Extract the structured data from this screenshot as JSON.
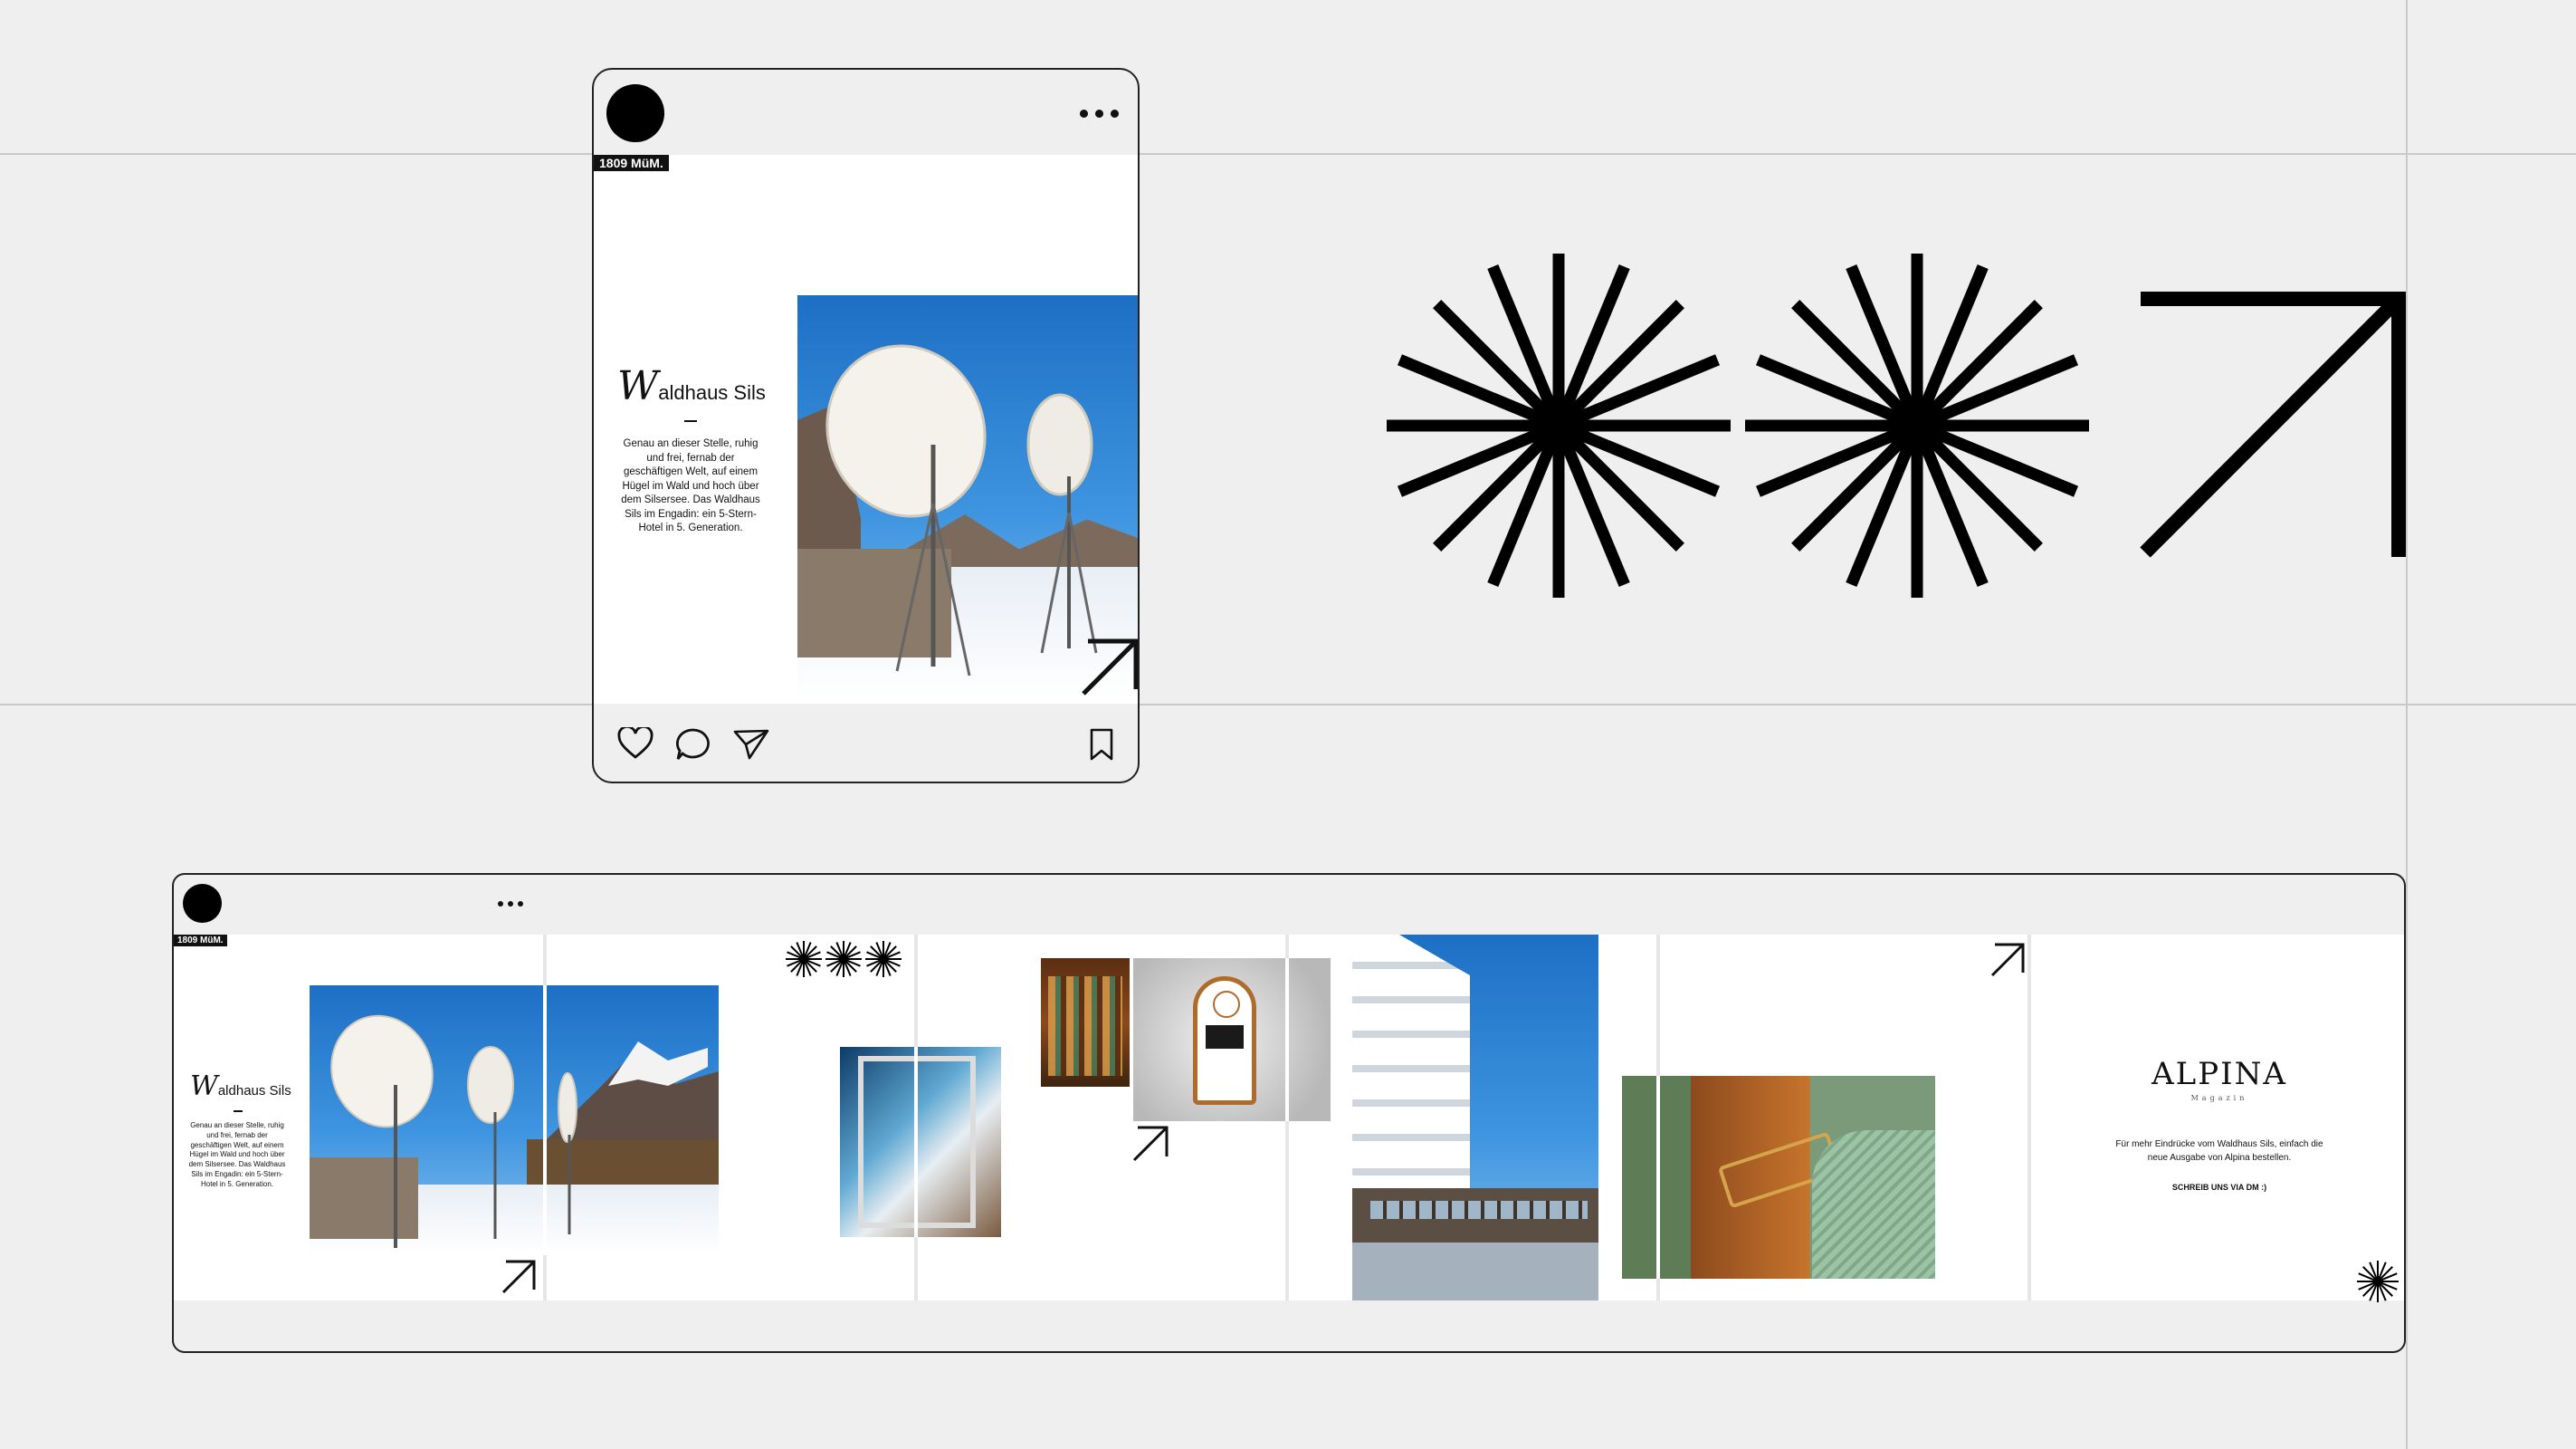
{
  "post": {
    "badge": "1809 MüM.",
    "title_initial": "W",
    "title_rest": "aldhaus Sils",
    "body": "Genau an dieser Stelle, ruhig und frei, fernab der geschäftigen Welt, auf einem Hügel im Wald und hoch über dem Silsersee. Das Waldhaus Sils im Engadin: ein 5-Stern-Hotel in 5. Generation."
  },
  "carousel": {
    "badge": "1809 MüM.",
    "title_initial": "W",
    "title_rest": "aldhaus Sils",
    "body": "Genau an dieser Stelle, ruhig und frei, fernab der geschäftigen Welt, auf einem Hügel im Wald und hoch über dem Silsersee. Das Waldhaus Sils im Engadin: ein 5-Stern-Hotel in 5. Generation.",
    "brand": "ALPINA",
    "brand_sub": "Magazin",
    "cta_text": "Für mehr Eindrücke vom Waldhaus Sils, einfach die neue Ausgabe von Alpina bestellen.",
    "cta_link": "SCHREIB UNS VIA DM :)"
  },
  "icons": {
    "actions": [
      "heart-icon",
      "comment-icon",
      "share-icon",
      "bookmark-icon"
    ],
    "graphics": [
      "starburst-icon",
      "starburst-icon",
      "arrow-up-right-icon"
    ]
  }
}
